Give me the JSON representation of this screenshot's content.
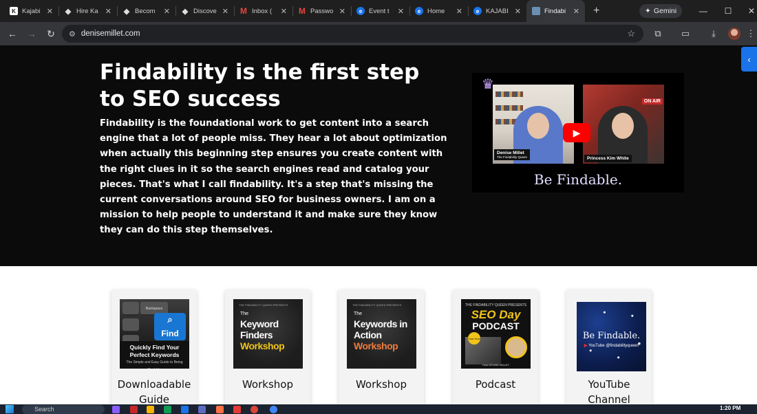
{
  "browser": {
    "tabs": [
      {
        "title": "Kajabi",
        "favicon": "kajabi-icon",
        "active": false
      },
      {
        "title": "Hire Ka",
        "favicon": "diamond-icon",
        "active": false
      },
      {
        "title": "Becom",
        "favicon": "diamond-icon",
        "active": false
      },
      {
        "title": "Discove",
        "favicon": "diamond-icon",
        "active": false
      },
      {
        "title": "Inbox (",
        "favicon": "gmail-icon",
        "active": false
      },
      {
        "title": "Passwo",
        "favicon": "gmail-icon",
        "active": false
      },
      {
        "title": "Event t",
        "favicon": "globe-icon",
        "active": false
      },
      {
        "title": "Home",
        "favicon": "globe-icon",
        "active": false
      },
      {
        "title": "KAJABI",
        "favicon": "globe-icon",
        "active": false
      },
      {
        "title": "Findabi",
        "favicon": "page-icon",
        "active": true
      }
    ],
    "new_tab_symbol": "+",
    "gemini_label": "Gemini",
    "url": "denisemillet.com"
  },
  "hero": {
    "title": "Findability is the first step to SEO success",
    "body": "Findability is the foundational work to get content into a search engine that a lot of people miss. They hear a lot about optimization when actually this beginning step ensures you create content with the right clues in it so the search engines read and catalog your pieces. That's what I call findability.  It's a step that's missing the current conversations around SEO for business owners.  I am on a mission to help people to understand it and make sure they know they can do this step themselves.",
    "video": {
      "left_name": "Denise Millet",
      "left_sub": "The Findability Queen",
      "right_name": "Princess Kim White",
      "on_air": "ON AIR",
      "caption": "Be Findable."
    }
  },
  "cards": [
    {
      "label": "Downloadable Guide",
      "thumb": {
        "key_word": "Find",
        "top_key": "Backspace",
        "title": "Quickly Find Your Perfect Keywords",
        "subtitle": "The Simple and Easy Guide to Being Findable"
      }
    },
    {
      "label": "Workshop",
      "thumb": {
        "small": "THE FINDABILITY QUEEN PRESENTS",
        "line1": "The",
        "line2": "Keyword Finders",
        "line3": "Workshop",
        "accent": "#f0c419"
      }
    },
    {
      "label": "Workshop",
      "thumb": {
        "small": "THE FINDABILITY QUEEN PRESENTS",
        "line1": "The",
        "line2": "Keywords in Action",
        "line3": "Workshop",
        "accent": "#ef7d3c"
      }
    },
    {
      "label": "Podcast",
      "thumb": {
        "top": "THE FINDABILITY QUEEN PRESENTS",
        "seo": "SEO Day",
        "podcast": "PODCAST",
        "sticker": "Your Host",
        "host": "Host DENISE MILLET"
      }
    },
    {
      "label": "YouTube Channel",
      "thumb": {
        "title": "Be Findable.",
        "yt": "YouTube",
        "handle": "@findabilityqueen"
      }
    }
  ],
  "taskbar": {
    "search_placeholder": "Search",
    "time": "1:20 PM"
  },
  "colors": {
    "hero_bg": "#0b0b0c",
    "youtube_red": "#ff0000",
    "side_tab_blue": "#1a73e8"
  }
}
